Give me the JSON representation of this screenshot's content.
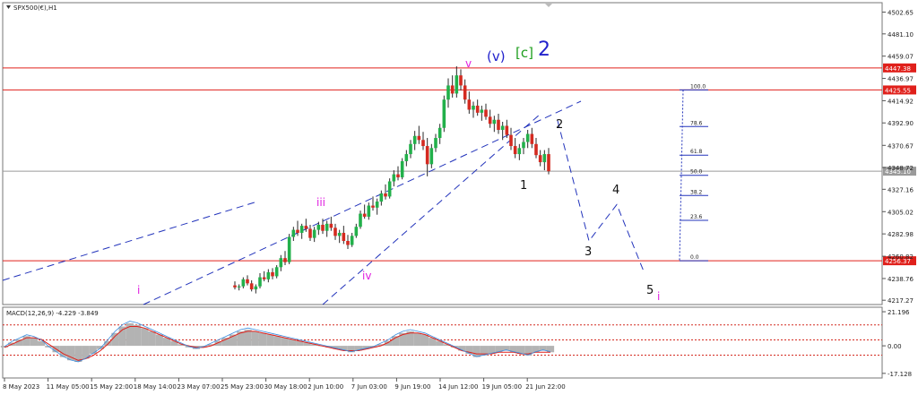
{
  "chart_data": {
    "type": "candlestick",
    "symbol_label": "SPX500(€),H1",
    "main_panel": {
      "y_ticks": [
        "4502.65",
        "4481.10",
        "4459.07",
        "4436.97",
        "4414.92",
        "4392.90",
        "4370.67",
        "4348.72",
        "4327.16",
        "4305.02",
        "4282.98",
        "4260.82",
        "4238.76",
        "4217.27"
      ],
      "y_tick_values": [
        4502.65,
        4481.1,
        4459.07,
        4436.97,
        4414.92,
        4392.9,
        4370.67,
        4348.72,
        4327.16,
        4305.02,
        4282.98,
        4260.82,
        4238.76,
        4217.27
      ],
      "ylim": [
        4213,
        4512
      ],
      "horizontal_levels": [
        {
          "value": 4447.38,
          "label": "4447.38",
          "color": "#e0201b"
        },
        {
          "value": 4425.55,
          "label": "4425.55",
          "color": "#e0201b"
        },
        {
          "value": 4256.37,
          "label": "4256.37",
          "color": "#e0201b"
        },
        {
          "value": 4345.1,
          "label": "4345.10",
          "color": "#9a9a9a"
        }
      ],
      "wave_labels": [
        {
          "text": "v",
          "color": "#e020e0"
        },
        {
          "text": "(v)",
          "color": "#2222cc"
        },
        {
          "text": "[c]",
          "color": "#1e9e1e"
        },
        {
          "text": "2",
          "color": "#2222cc"
        },
        {
          "text": "iii",
          "color": "#e020e0"
        },
        {
          "text": "iv",
          "color": "#e020e0"
        },
        {
          "text": "i",
          "color": "#e020e0"
        },
        {
          "text": "1",
          "color": "#111111"
        },
        {
          "text": "2",
          "color": "#111111"
        },
        {
          "text": "3",
          "color": "#111111"
        },
        {
          "text": "4",
          "color": "#111111"
        },
        {
          "text": "5",
          "color": "#111111"
        },
        {
          "text": "i",
          "color": "#e020e0"
        }
      ],
      "fib_levels": [
        {
          "label": "100.0",
          "value": 4425.55
        },
        {
          "label": "78.6",
          "value": 4389.3
        },
        {
          "label": "61.8",
          "value": 4361.0
        },
        {
          "label": "50.0",
          "value": 4341.0
        },
        {
          "label": "38.2",
          "value": 4321.0
        },
        {
          "label": "23.6",
          "value": 4296.4
        },
        {
          "label": "0.0",
          "value": 4256.37
        }
      ],
      "projection_path": [
        4395,
        4276,
        4312,
        4246
      ],
      "candles": [
        [
          4232,
          4236,
          4228,
          4230
        ],
        [
          4230,
          4233,
          4227,
          4231
        ],
        [
          4231,
          4240,
          4229,
          4238
        ],
        [
          4238,
          4242,
          4232,
          4234
        ],
        [
          4234,
          4237,
          4226,
          4228
        ],
        [
          4228,
          4233,
          4224,
          4231
        ],
        [
          4231,
          4244,
          4229,
          4240
        ],
        [
          4240,
          4246,
          4236,
          4238
        ],
        [
          4238,
          4248,
          4235,
          4245
        ],
        [
          4245,
          4249,
          4238,
          4241
        ],
        [
          4241,
          4252,
          4239,
          4250
        ],
        [
          4250,
          4262,
          4246,
          4259
        ],
        [
          4259,
          4266,
          4252,
          4255
        ],
        [
          4255,
          4283,
          4253,
          4280
        ],
        [
          4280,
          4290,
          4276,
          4287
        ],
        [
          4287,
          4296,
          4281,
          4284
        ],
        [
          4284,
          4293,
          4278,
          4291
        ],
        [
          4291,
          4298,
          4285,
          4288
        ],
        [
          4288,
          4292,
          4276,
          4279
        ],
        [
          4279,
          4290,
          4275,
          4287
        ],
        [
          4287,
          4295,
          4282,
          4292
        ],
        [
          4292,
          4298,
          4283,
          4286
        ],
        [
          4286,
          4296,
          4280,
          4293
        ],
        [
          4293,
          4300,
          4286,
          4289
        ],
        [
          4289,
          4293,
          4277,
          4281
        ],
        [
          4281,
          4287,
          4274,
          4284
        ],
        [
          4284,
          4291,
          4273,
          4276
        ],
        [
          4276,
          4282,
          4268,
          4272
        ],
        [
          4272,
          4284,
          4270,
          4281
        ],
        [
          4281,
          4293,
          4279,
          4290
        ],
        [
          4290,
          4306,
          4288,
          4303
        ],
        [
          4303,
          4312,
          4298,
          4300
        ],
        [
          4300,
          4314,
          4297,
          4311
        ],
        [
          4311,
          4320,
          4306,
          4309
        ],
        [
          4309,
          4318,
          4302,
          4315
        ],
        [
          4315,
          4326,
          4311,
          4323
        ],
        [
          4323,
          4332,
          4317,
          4320
        ],
        [
          4320,
          4338,
          4318,
          4335
        ],
        [
          4335,
          4346,
          4330,
          4342
        ],
        [
          4342,
          4350,
          4336,
          4339
        ],
        [
          4339,
          4358,
          4337,
          4355
        ],
        [
          4355,
          4366,
          4350,
          4362
        ],
        [
          4362,
          4376,
          4358,
          4372
        ],
        [
          4372,
          4385,
          4366,
          4380
        ],
        [
          4380,
          4390,
          4372,
          4376
        ],
        [
          4376,
          4384,
          4366,
          4370
        ],
        [
          4370,
          4378,
          4340,
          4352
        ],
        [
          4352,
          4372,
          4348,
          4368
        ],
        [
          4368,
          4382,
          4364,
          4378
        ],
        [
          4378,
          4392,
          4372,
          4388
        ],
        [
          4388,
          4420,
          4384,
          4416
        ],
        [
          4416,
          4437,
          4408,
          4430
        ],
        [
          4430,
          4440,
          4418,
          4422
        ],
        [
          4422,
          4449,
          4418,
          4440
        ],
        [
          4440,
          4446,
          4425,
          4430
        ],
        [
          4430,
          4436,
          4412,
          4416
        ],
        [
          4416,
          4424,
          4402,
          4406
        ],
        [
          4406,
          4414,
          4398,
          4410
        ],
        [
          4410,
          4416,
          4400,
          4403
        ],
        [
          4403,
          4410,
          4395,
          4406
        ],
        [
          4406,
          4412,
          4396,
          4399
        ],
        [
          4399,
          4406,
          4388,
          4392
        ],
        [
          4392,
          4400,
          4384,
          4396
        ],
        [
          4396,
          4402,
          4382,
          4386
        ],
        [
          4386,
          4394,
          4376,
          4390
        ],
        [
          4390,
          4396,
          4378,
          4381
        ],
        [
          4381,
          4388,
          4366,
          4370
        ],
        [
          4370,
          4378,
          4358,
          4362
        ],
        [
          4362,
          4372,
          4356,
          4368
        ],
        [
          4368,
          4378,
          4362,
          4374
        ],
        [
          4374,
          4386,
          4368,
          4382
        ],
        [
          4382,
          4388,
          4368,
          4372
        ],
        [
          4372,
          4378,
          4358,
          4361
        ],
        [
          4361,
          4366,
          4350,
          4354
        ],
        [
          4354,
          4366,
          4346,
          4362
        ],
        [
          4362,
          4368,
          4342,
          4345
        ]
      ]
    },
    "macd_panel": {
      "label": "MACD(12,26,9) -4.229 -3.849",
      "y_ticks": [
        "21.196",
        "0.00",
        "-17.128"
      ],
      "y_tick_values": [
        21.196,
        0,
        -17.128
      ],
      "ylim": [
        -20,
        24
      ],
      "dotted_levels": [
        13,
        3.7,
        -5.8
      ],
      "histogram": [
        -1,
        2,
        4,
        6,
        5,
        3,
        -1,
        -4,
        -7,
        -9,
        -10,
        -8,
        -5,
        -2,
        3,
        8,
        12,
        14,
        13,
        11,
        9,
        7,
        5,
        3,
        1,
        -1,
        -2,
        -1,
        1,
        3,
        5,
        7,
        9,
        10,
        9,
        8,
        7,
        6,
        5,
        4,
        3,
        2,
        1,
        0,
        -1,
        -2,
        -3,
        -4,
        -3,
        -2,
        -1,
        1,
        3,
        6,
        8,
        9,
        8,
        7,
        5,
        3,
        1,
        -1,
        -3,
        -5,
        -7,
        -6,
        -5,
        -4,
        -3,
        -4,
        -5,
        -6,
        -4,
        -3,
        -4
      ],
      "signal": [
        -1,
        1,
        3,
        5,
        5,
        4,
        1,
        -2,
        -5,
        -7,
        -9,
        -8,
        -6,
        -3,
        1,
        6,
        10,
        12,
        12,
        11,
        9,
        7,
        5,
        3,
        1,
        0,
        -1,
        -1,
        0,
        2,
        4,
        6,
        8,
        9,
        9,
        8,
        7,
        6,
        5,
        4,
        3,
        2,
        1,
        0,
        -1,
        -2,
        -3,
        -3,
        -3,
        -2,
        -1,
        0,
        2,
        5,
        7,
        8,
        8,
        7,
        5,
        3,
        1,
        -1,
        -3,
        -4,
        -5,
        -5,
        -5,
        -4,
        -4,
        -4,
        -5,
        -5,
        -4,
        -4,
        -4
      ]
    },
    "x_ticks": [
      "8 May 2023",
      "11 May 05:00",
      "15 May 22:00",
      "18 May 14:00",
      "23 May 07:00",
      "25 May 23:00",
      "30 May 18:00",
      "2 Jun 10:00",
      "7 Jun 03:00",
      "9 Jun 19:00",
      "14 Jun 12:00",
      "19 Jun 05:00",
      "21 Jun 22:00"
    ]
  }
}
